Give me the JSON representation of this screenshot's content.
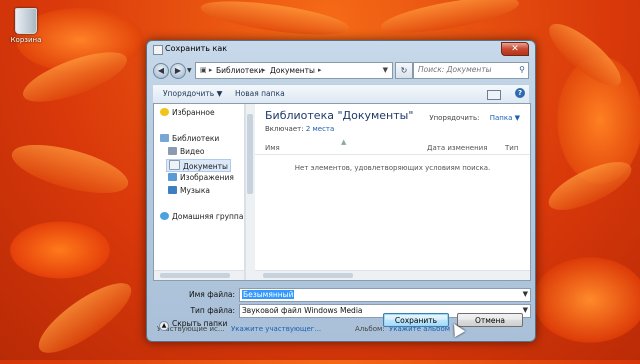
{
  "desktop": {
    "recycle_bin_label": "Корзина"
  },
  "window": {
    "title": "Сохранить как",
    "close_symbol": "✕"
  },
  "nav": {
    "back": "◀",
    "forward": "▶",
    "dropdown": "▼",
    "address_segments": [
      "Библиотеки",
      "Документы"
    ],
    "refresh": "↻",
    "search_placeholder": "Поиск: Документы"
  },
  "toolbar": {
    "organize": "Упорядочить ▼",
    "new_folder": "Новая папка",
    "help": "?"
  },
  "sidebar": {
    "items": [
      {
        "label": "Избранное",
        "icon": "star-icon",
        "color": "#f0c419"
      },
      {
        "label": "Библиотеки",
        "icon": "library-icon",
        "color": "#7aa6d6"
      },
      {
        "label": "Видео",
        "icon": "video-icon",
        "color": "#8a9bb0"
      },
      {
        "label": "Документы",
        "icon": "documents-icon",
        "color": "#d8e2ee",
        "selected": true
      },
      {
        "label": "Изображения",
        "icon": "images-icon",
        "color": "#5b9bd5"
      },
      {
        "label": "Музыка",
        "icon": "music-icon",
        "color": "#3e7ec2"
      },
      {
        "label": "Домашняя группа",
        "icon": "homegroup-icon",
        "color": "#4aa3df"
      }
    ]
  },
  "library": {
    "title": "Библиотека \"Документы\"",
    "includes_label": "Включает:",
    "includes_link": "2 места",
    "arrange_label": "Упорядочить:",
    "arrange_value": "Папка ▼"
  },
  "columns": [
    "Имя",
    "Дата изменения",
    "Тип"
  ],
  "empty_message": "Нет элементов, удовлетворяющих условиям поиска.",
  "form": {
    "filename_label": "Имя файла:",
    "filename_value": "Безымянный",
    "filetype_label": "Тип файла:",
    "filetype_value": "Звуковой файл Windows Media",
    "participants_label": "Участвующие ис...",
    "participants_link": "Укажите участвующег...",
    "album_label": "Альбом:",
    "album_link": "Укажите альбом"
  },
  "footer": {
    "hide_folders": "Скрыть папки",
    "save": "Сохранить",
    "cancel": "Отмена"
  }
}
